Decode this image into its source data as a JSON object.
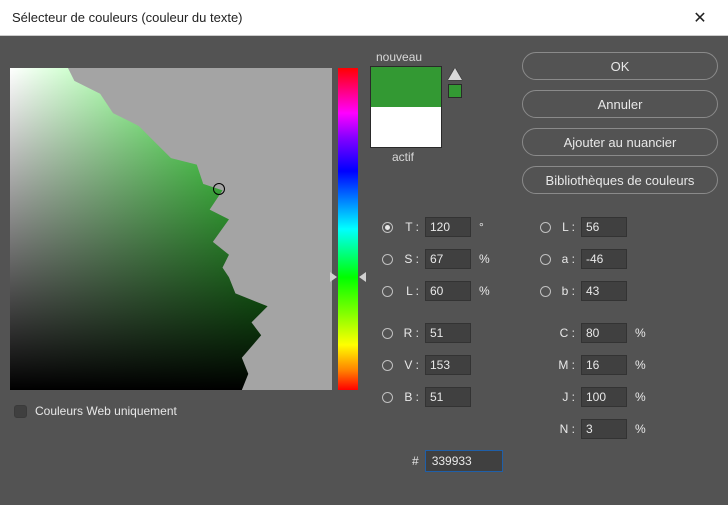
{
  "title": "Sélecteur de couleurs (couleur du texte)",
  "swatch": {
    "new_label": "nouveau",
    "active_label": "actif"
  },
  "buttons": {
    "ok": "OK",
    "cancel": "Annuler",
    "add": "Ajouter au nuancier",
    "libs": "Bibliothèques de couleurs"
  },
  "web_only": "Couleurs Web uniquement",
  "labels": {
    "T": "T :",
    "S": "S :",
    "Lhsl": "L :",
    "R": "R :",
    "V": "V :",
    "B": "B :",
    "L": "L :",
    "a": "a :",
    "b": "b :",
    "C": "C :",
    "M": "M :",
    "J": "J :",
    "N": "N :",
    "hash": "#"
  },
  "units": {
    "deg": "°",
    "pct": "%"
  },
  "values": {
    "T": "120",
    "S": "67",
    "Lhsl": "60",
    "R": "51",
    "V": "153",
    "B": "51",
    "L": "56",
    "a": "-46",
    "b": "43",
    "C": "80",
    "M": "16",
    "J": "100",
    "N": "3",
    "hex": "339933"
  }
}
